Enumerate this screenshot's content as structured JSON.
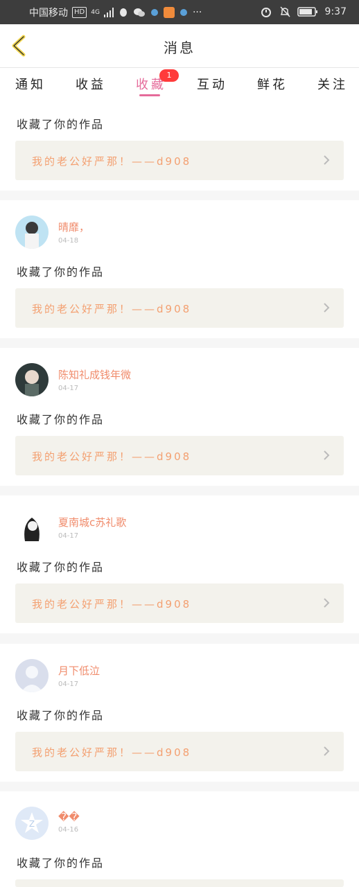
{
  "status_bar": {
    "carrier": "中国移动",
    "hd": "HD",
    "network": "4G",
    "more": "···",
    "time": "9:37"
  },
  "header": {
    "title": "消息"
  },
  "tabs": [
    {
      "label": "通知"
    },
    {
      "label": "收益"
    },
    {
      "label": "收藏",
      "badge": "1",
      "active": true
    },
    {
      "label": "互动"
    },
    {
      "label": "鲜花"
    },
    {
      "label": "关注"
    }
  ],
  "items": [
    {
      "user": "",
      "time": "",
      "action": "收藏了你的作品",
      "work": "我的老公好严那！——d908"
    },
    {
      "user": "晴靡，",
      "time": "04-18",
      "action": "收藏了你的作品",
      "work": "我的老公好严那！——d908"
    },
    {
      "user": "陈知礼成钱年微",
      "time": "04-17",
      "action": "收藏了你的作品",
      "work": "我的老公好严那！——d908"
    },
    {
      "user": "夏南城c苏礼歌",
      "time": "04-17",
      "action": "收藏了你的作品",
      "work": "我的老公好严那！——d908"
    },
    {
      "user": "月下低泣",
      "time": "04-17",
      "action": "收藏了你的作品",
      "work": "我的老公好严那！——d908"
    },
    {
      "user": "��",
      "time": "04-16",
      "action": "收藏了你的作品",
      "work": ""
    }
  ]
}
